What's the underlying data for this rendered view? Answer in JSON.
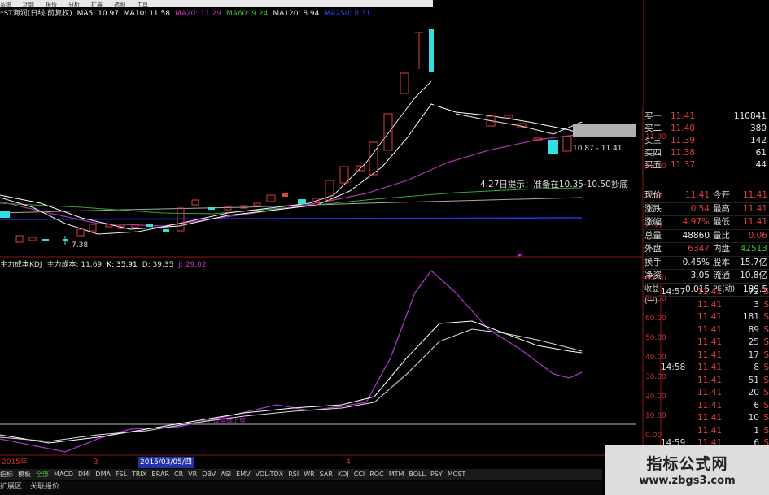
{
  "menu": [
    "系统",
    "功能",
    "报价",
    "分析",
    "扩展",
    "选股",
    "工具"
  ],
  "header": {
    "name": "*ST海润(日线,前复权)",
    "ma5": "MA5: 10.97",
    "ma10": "MA10: 11.58",
    "ma20": "MA20: 11.29",
    "ma60": "MA60: 9.24",
    "ma120": "MA120: 8.94",
    "ma250": "MA250: 8.31"
  },
  "colors": {
    "ma5": "#ffffff",
    "ma10": "#ffffff",
    "ma20": "#cc33cc",
    "ma60": "#33cc33",
    "ma120": "#cccccc",
    "ma250": "#3344ff",
    "up": "#e04040",
    "down": "#33e0e0"
  },
  "annotations": {
    "hint": "4.27日提示：准备在10.35-10.50抄底",
    "low": "7.38",
    "range": "10.87 - 11.41",
    "kdj_cross": "主力成本线上穿"
  },
  "price_axis": [
    "11.00",
    "10.00",
    "9.00",
    "8.00"
  ],
  "kdj": {
    "label": "主力成本KDJ",
    "cost": "主力成本: 11.69",
    "k": "K: 35.91",
    "d": "D: 39.35",
    "j": "J: 29.02",
    "axis": [
      "80.00",
      "70.00",
      "60.00",
      "50.00",
      "40.00",
      "30.00",
      "20.00",
      "10.00",
      "0.00"
    ]
  },
  "orders": [
    {
      "label": "买一",
      "price": "11.41",
      "vol": "110841"
    },
    {
      "label": "买二",
      "price": "11.40",
      "vol": "380"
    },
    {
      "label": "买三",
      "price": "11.39",
      "vol": "142"
    },
    {
      "label": "买四",
      "price": "11.38",
      "vol": "61"
    },
    {
      "label": "买五",
      "price": "11.37",
      "vol": "44"
    }
  ],
  "stats": [
    {
      "k1": "现价",
      "v1": "11.41",
      "k2": "今开",
      "v2": "11.41"
    },
    {
      "k1": "涨跌",
      "v1": "0.54",
      "k2": "最高",
      "v2": "11.41"
    },
    {
      "k1": "涨幅",
      "v1": "4.97%",
      "k2": "最低",
      "v2": "11.41"
    },
    {
      "k1": "总量",
      "v1": "48860",
      "k2": "量比",
      "v2": "0.06"
    },
    {
      "k1": "外盘",
      "v1": "6347",
      "k2": "内盘",
      "v2": "42513"
    },
    {
      "k1": "换手",
      "v1": "0.45%",
      "k2": "股本",
      "v2": "15.7亿"
    },
    {
      "k1": "净资",
      "v1": "3.05",
      "k2": "流通",
      "v2": "10.8亿"
    },
    {
      "k1": "收益(一)",
      "v1": "0.015",
      "k2": "PE(动)",
      "v2": "189.5"
    }
  ],
  "ticks": [
    {
      "time": "14:57",
      "price": "11.41",
      "vol": "72",
      "flag": "S"
    },
    {
      "time": "",
      "price": "11.41",
      "vol": "3",
      "flag": "S"
    },
    {
      "time": "",
      "price": "11.41",
      "vol": "181",
      "flag": "S"
    },
    {
      "time": "",
      "price": "11.41",
      "vol": "89",
      "flag": "S"
    },
    {
      "time": "",
      "price": "11.41",
      "vol": "25",
      "flag": "S"
    },
    {
      "time": "",
      "price": "11.41",
      "vol": "17",
      "flag": "S"
    },
    {
      "time": "14:58",
      "price": "11.41",
      "vol": "8",
      "flag": "S"
    },
    {
      "time": "",
      "price": "11.41",
      "vol": "51",
      "flag": "S"
    },
    {
      "time": "",
      "price": "11.41",
      "vol": "20",
      "flag": "S"
    },
    {
      "time": "",
      "price": "11.41",
      "vol": "6",
      "flag": "S"
    },
    {
      "time": "",
      "price": "11.41",
      "vol": "10",
      "flag": "S"
    },
    {
      "time": "",
      "price": "11.41",
      "vol": "1",
      "flag": "S"
    },
    {
      "time": "14:59",
      "price": "11.41",
      "vol": "6",
      "flag": "S"
    }
  ],
  "dates": {
    "start": "2015年",
    "m3": "3",
    "selected": "2015/03/05/四",
    "m4": "4"
  },
  "tabs": [
    "指标",
    "模板",
    "全部",
    "MACD",
    "DMI",
    "DMA",
    "FSL",
    "TRIX",
    "BRAR",
    "CR",
    "VR",
    "OBV",
    "ASI",
    "EMV",
    "VOL-TDX",
    "RSI",
    "WR",
    "SAR",
    "KDJ",
    "CCI",
    "ROC",
    "MTM",
    "BOLL",
    "PSY",
    "MCST"
  ],
  "bottom": [
    "扩展区",
    "关联报价"
  ],
  "watermark": {
    "title": "指标公式网",
    "url": "www.zbgs3.com"
  }
}
